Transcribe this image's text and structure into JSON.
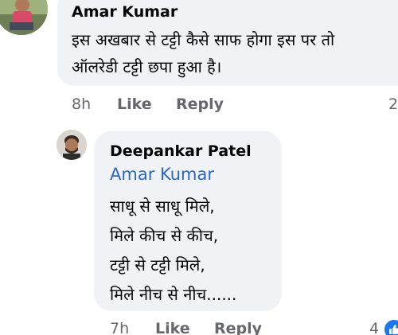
{
  "comments": [
    {
      "author": "Amar Kumar",
      "text_lines": [
        "इस अखबार से टट्टी कैसे साफ होगा इस पर तो",
        "ऑलरेडी टट्टी छपा हुआ है।"
      ],
      "time": "8h",
      "like_label": "Like",
      "reply_label": "Reply",
      "reaction_count": "2",
      "avatar_icon": "user-avatar-photo"
    },
    {
      "author": "Deepankar Patel",
      "mention": "Amar Kumar",
      "text_lines": [
        "साधू से साधू मिले,",
        "मिले कीच से कीच,",
        "टट्टी से टट्टी मिले,",
        "मिले नीच से नीच......"
      ],
      "time": "7h",
      "like_label": "Like",
      "reply_label": "Reply",
      "reaction_count": "4",
      "reaction_icon": "thumbs-up-icon",
      "avatar_icon": "user-avatar-photo"
    }
  ],
  "colors": {
    "bubble": "#f0f2f5",
    "meta": "#65676b",
    "mention": "#2768c8",
    "like_badge": "#1877f2"
  }
}
